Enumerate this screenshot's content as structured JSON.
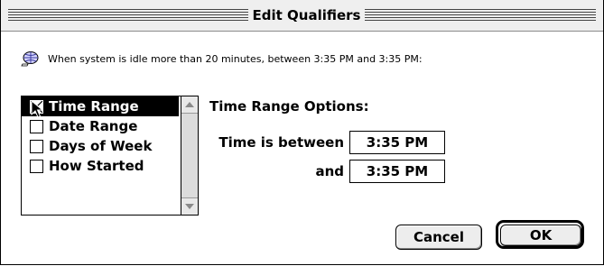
{
  "window": {
    "title": "Edit Qualifiers"
  },
  "info": {
    "icon": "globe-script-icon",
    "text": "When system is idle more than 20 minutes, between 3:35 PM and 3:35 PM:"
  },
  "qualifier_list": {
    "items": [
      {
        "label": "Time Range",
        "checked": true,
        "selected": true
      },
      {
        "label": "Date Range",
        "checked": false,
        "selected": false
      },
      {
        "label": "Days of Week",
        "checked": false,
        "selected": false
      },
      {
        "label": "How Started",
        "checked": false,
        "selected": false
      }
    ]
  },
  "options": {
    "title": "Time Range Options:",
    "between_label": "Time is between",
    "and_label": "and",
    "start_time": "3:35 PM",
    "end_time": "3:35 PM"
  },
  "buttons": {
    "cancel": "Cancel",
    "ok": "OK"
  },
  "colors": {
    "selection": "#000000",
    "title_bar": "#efefef",
    "button_face": "#ededed"
  }
}
